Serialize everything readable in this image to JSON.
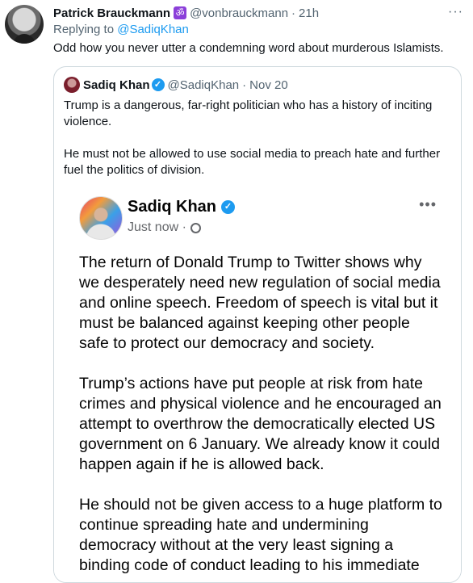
{
  "tweet": {
    "author_name": "Patrick Brauckmann",
    "author_badge": "ॐ",
    "author_handle": "@vonbrauckmann",
    "dot": "·",
    "time": "21h",
    "more": "···",
    "reply_prefix": "Replying to",
    "reply_to": "@SadiqKhan",
    "text": "Odd how you never utter a condemning word about murderous Islamists."
  },
  "quote": {
    "author_name": "Sadiq Khan",
    "author_handle": "@SadiqKhan",
    "dot": "·",
    "time": "Nov 20",
    "paragraphs": [
      "Trump is a dangerous, far-right politician who has a history of inciting violence.",
      "He must not be allowed to use social media to preach hate and further fuel the politics of division."
    ]
  },
  "fb_post": {
    "author_name": "Sadiq Khan",
    "time": "Just now ·",
    "more": "•••",
    "paragraphs": [
      "The return of Donald Trump to Twitter shows why we desperately need new regulation of social media and online speech. Freedom of speech is vital but it must be balanced against keeping other people safe to protect our democracy and society.",
      "Trump’s actions have put people at risk from hate crimes and physical violence and he encouraged an attempt to overthrow the democratically elected US government on 6 January. We already know it could happen again if he is allowed back.",
      "He should not be given access to a huge platform to continue spreading hate and undermining democracy without at the very least signing a binding code of conduct leading to his immediate"
    ]
  },
  "colors": {
    "link": "#1d9bf0",
    "secondary_text": "#536471",
    "verified": "#1d9bf0",
    "border": "#cfd9de"
  },
  "icons": [
    "verified-icon",
    "globe-icon",
    "more-icon",
    "om-badge-icon"
  ]
}
